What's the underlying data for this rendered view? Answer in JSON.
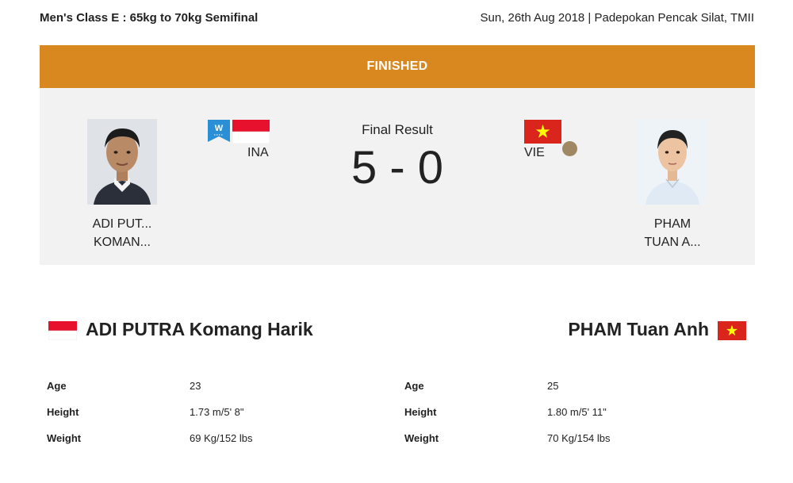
{
  "header": {
    "event_title": "Men's Class E : 65kg to 70kg Semifinal",
    "event_meta": "Sun, 26th Aug 2018 | Padepokan Pencak Silat, TMII"
  },
  "status": "FINISHED",
  "result": {
    "label": "Final Result",
    "score": "5 - 0"
  },
  "players": {
    "left": {
      "short_line1": "ADI PUT...",
      "short_line2": "KOMAN...",
      "country_code": "INA",
      "winner_badge": "W",
      "full_name": "ADI PUTRA Komang Harik",
      "stats": [
        {
          "label": "Age",
          "value": "23"
        },
        {
          "label": "Height",
          "value": "1.73 m/5' 8\""
        },
        {
          "label": "Weight",
          "value": "69 Kg/152 lbs"
        }
      ]
    },
    "right": {
      "short_line1": "PHAM",
      "short_line2": "TUAN A...",
      "country_code": "VIE",
      "full_name": "PHAM Tuan Anh",
      "stats": [
        {
          "label": "Age",
          "value": "25"
        },
        {
          "label": "Height",
          "value": "1.80 m/5' 11\""
        },
        {
          "label": "Weight",
          "value": "70 Kg/154 lbs"
        }
      ]
    }
  },
  "colors": {
    "status_bar": "#d9871f",
    "card_bg": "#f2f2f2",
    "winner_badge": "#2b8fd6",
    "flag_red": "#e8112d",
    "vie_red": "#da251d",
    "vie_star": "#ffff00"
  }
}
